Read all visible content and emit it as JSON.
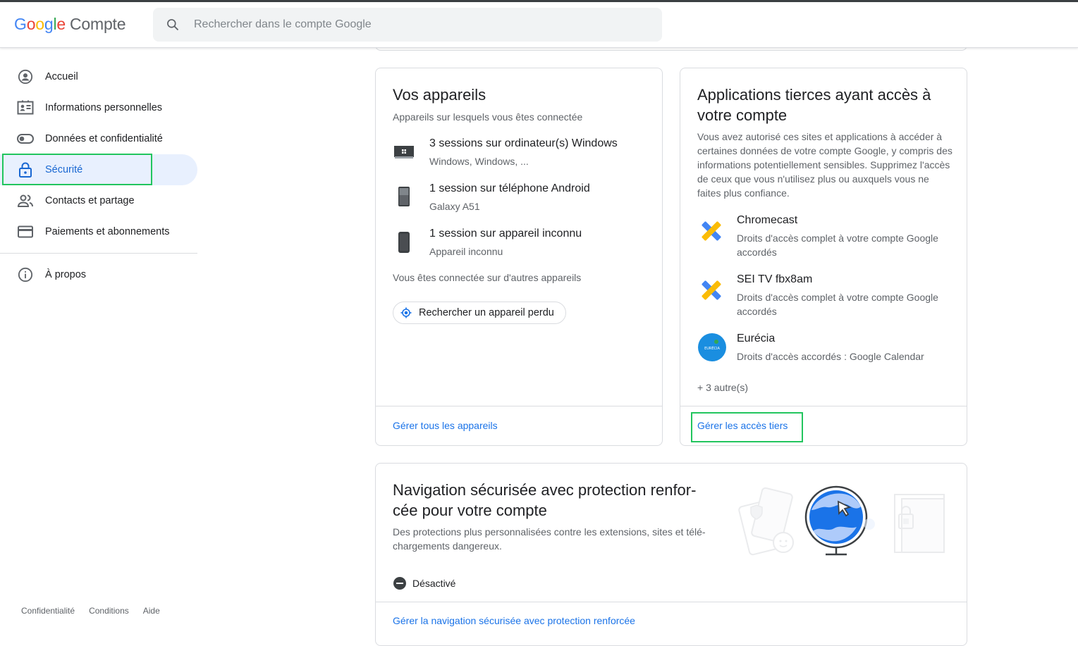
{
  "header": {
    "logo_letters": [
      "G",
      "o",
      "o",
      "g",
      "l",
      "e"
    ],
    "product": "Compte",
    "search_placeholder": "Rechercher dans le compte Google"
  },
  "nav": {
    "items": [
      {
        "label": "Accueil",
        "icon": "account-circle-icon"
      },
      {
        "label": "Informations personnelles",
        "icon": "id-card-icon"
      },
      {
        "label": "Données et confidentialité",
        "icon": "toggle-icon"
      },
      {
        "label": "Sécurité",
        "icon": "lock-icon",
        "active": true
      },
      {
        "label": "Contacts et partage",
        "icon": "people-icon"
      },
      {
        "label": "Paiements et abonnements",
        "icon": "credit-card-icon"
      }
    ],
    "about": {
      "label": "À propos",
      "icon": "info-icon"
    }
  },
  "footer": {
    "privacy": "Confidentialité",
    "terms": "Conditions",
    "help": "Aide"
  },
  "devices": {
    "title": "Vos appareils",
    "subtitle": "Appareils sur lesquels vous êtes connectée",
    "rows": [
      {
        "title": "3 sessions sur ordinateur(s) Windows",
        "detail": "Windows, Windows, ...",
        "icon": "laptop-icon"
      },
      {
        "title": "1 session sur téléphone Android",
        "detail": "Galaxy A51",
        "icon": "phone-icon"
      },
      {
        "title": "1 session sur appareil inconnu",
        "detail": "Appareil inconnu",
        "icon": "unknown-device-icon"
      }
    ],
    "other": "Vous êtes connectée sur d'autres appareils",
    "find_button": "Rechercher un appareil perdu",
    "manage_link": "Gérer tous les appareils"
  },
  "third_party": {
    "title": "Applications tierces ayant accès à votre compte",
    "description": "Vous avez autorisé ces sites et applications à accéder à certaines données de votre compte Google, y compris des informations potentiellement sensibles. Supprimez l'accès de ceux que vous n'utilisez plus ou auxquels vous ne faites plus confiance.",
    "apps": [
      {
        "name": "Chromecast",
        "access": "Droits d'accès complet à votre compte Google accordés",
        "icon": "app-puzzle-icon"
      },
      {
        "name": "SEI TV fbx8am",
        "access": "Droits d'accès complet à votre compte Google accordés",
        "icon": "app-puzzle-icon"
      },
      {
        "name": "Eurécia",
        "access": "Droits d'accès accordés : Google Calendar",
        "icon": "eurecia-logo-icon",
        "logo_text": "EURÉCIA"
      }
    ],
    "more": "+ 3 autre(s)",
    "manage_link": "Gérer les accès tiers"
  },
  "safe_browsing": {
    "title": "Navigation sécurisée avec protection renfor-cée pour votre compte",
    "title_line1": "Navigation sécurisée avec protection renfor-",
    "title_line2": "cée pour votre compte",
    "description": "Des protections plus personnalisées contre les extensions, sites et télé-chargements dangereux.",
    "status": "Désactivé",
    "manage_link": "Gérer la navigation sécurisée avec protection renforcée"
  },
  "colors": {
    "accent": "#1a73e8",
    "active_bg": "#e8f0fe",
    "highlight": "#22c55e"
  }
}
